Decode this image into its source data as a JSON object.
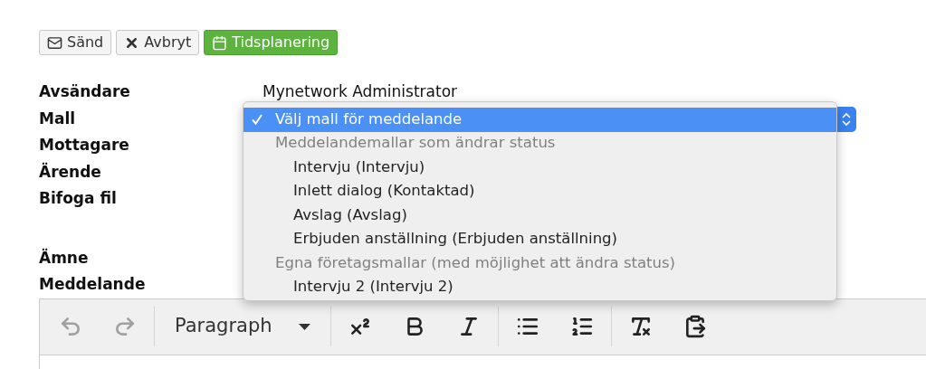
{
  "actions": [
    {
      "kind": "send",
      "label": "Sänd"
    },
    {
      "kind": "cancel",
      "label": "Avbryt"
    },
    {
      "kind": "schedule",
      "label": "Tidsplanering"
    }
  ],
  "form": [
    {
      "label": "Avsändare",
      "value": "Mynetwork Administrator"
    },
    {
      "label": "Mall"
    },
    {
      "label": "Mottagare"
    },
    {
      "label": "Ärende"
    },
    {
      "label": "Bifoga fil"
    },
    {
      "label": "Ämne"
    },
    {
      "label": "Meddelande"
    }
  ],
  "template_menu": [
    {
      "kind": "option",
      "label": "Välj mall för meddelande",
      "selected": true
    },
    {
      "kind": "group",
      "label": "Meddelandemallar som ändrar status"
    },
    {
      "kind": "option",
      "label": "Intervju (Intervju)",
      "selected": false
    },
    {
      "kind": "option",
      "label": "Inlett dialog (Kontaktad)",
      "selected": false
    },
    {
      "kind": "option",
      "label": "Avslag (Avslag)",
      "selected": false
    },
    {
      "kind": "option",
      "label": "Erbjuden anställning (Erbjuden anställning)",
      "selected": false
    },
    {
      "kind": "group",
      "label": "Egna företagsmallar (med möjlighet att ändra status)"
    },
    {
      "kind": "option",
      "label": "Intervju 2 (Intervju 2)",
      "selected": false
    }
  ],
  "editor_toolbar": [
    {
      "kind": "undo",
      "disabled": true
    },
    {
      "kind": "redo",
      "disabled": true
    },
    {
      "kind": "format",
      "label": "Paragraph"
    },
    {
      "kind": "superscript",
      "disabled": false
    },
    {
      "kind": "bold",
      "disabled": false
    },
    {
      "kind": "italic",
      "disabled": false
    },
    {
      "kind": "bullet-list",
      "disabled": false
    },
    {
      "kind": "numbered-list",
      "disabled": false
    },
    {
      "kind": "clear-format",
      "disabled": false
    },
    {
      "kind": "paste-text",
      "disabled": false
    }
  ]
}
